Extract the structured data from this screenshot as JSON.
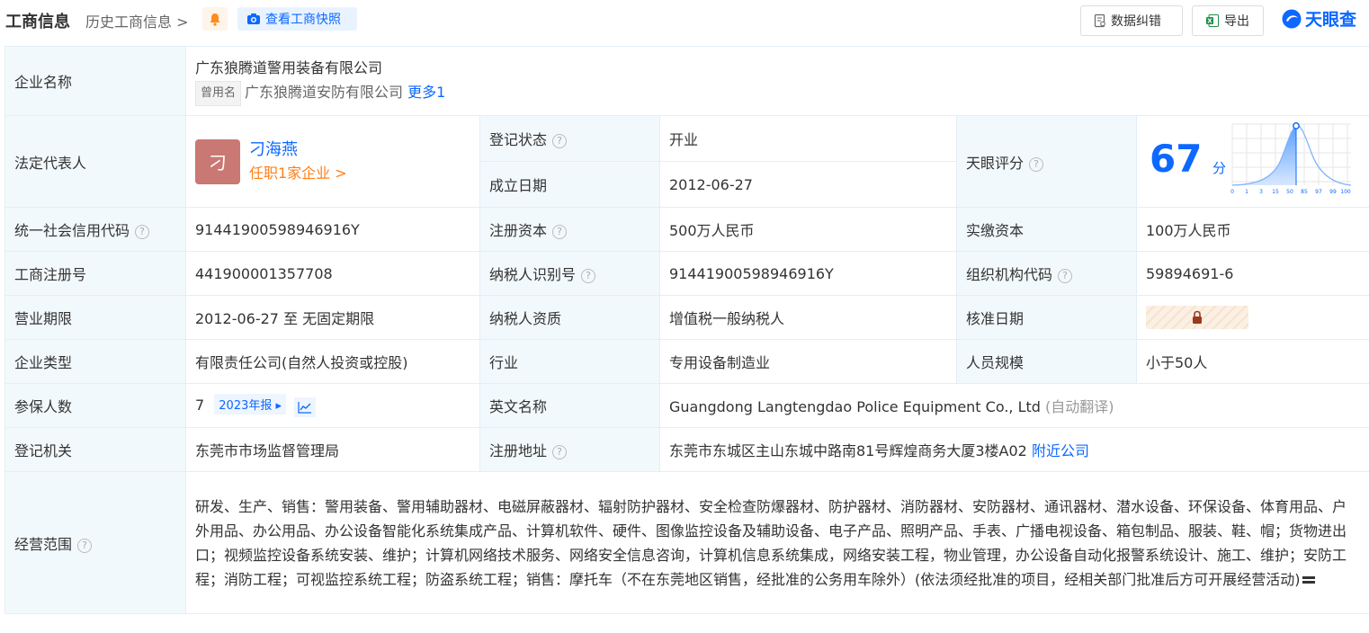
{
  "header": {
    "title": "工商信息",
    "history_label": "历史工商信息",
    "snapshot_label": "查看工商快照",
    "correct_label": "数据纠错",
    "export_label": "导出",
    "logo_text": "天眼查"
  },
  "rows": {
    "company_name": {
      "label": "企业名称",
      "value": "广东狼腾道警用装备有限公司",
      "former_tag": "曾用名",
      "former_value": "广东狼腾道安防有限公司",
      "more": "更多1"
    },
    "legal": {
      "label": "法定代表人",
      "avatar_char": "刁",
      "name": "刁海燕",
      "sub": "任职1家企业"
    },
    "reg_status": {
      "label": "登记状态",
      "value": "开业"
    },
    "found_date": {
      "label": "成立日期",
      "value": "2012-06-27"
    },
    "score": {
      "label": "天眼评分",
      "value": "67",
      "unit": "分",
      "ticks": [
        "0",
        "1",
        "3",
        "15",
        "50",
        "85",
        "97",
        "99",
        "100"
      ]
    },
    "credit_code": {
      "label": "统一社会信用代码",
      "value": "91441900598946916Y"
    },
    "reg_capital": {
      "label": "注册资本",
      "value": "500万人民币"
    },
    "paid_capital": {
      "label": "实缴资本",
      "value": "100万人民币"
    },
    "reg_no": {
      "label": "工商注册号",
      "value": "441900001357708"
    },
    "tax_id": {
      "label": "纳税人识别号",
      "value": "91441900598946916Y"
    },
    "org_code": {
      "label": "组织机构代码",
      "value": "59894691-6"
    },
    "term": {
      "label": "营业期限",
      "value": "2012-06-27 至 无固定期限"
    },
    "tax_qual": {
      "label": "纳税人资质",
      "value": "增值税一般纳税人"
    },
    "approve_date": {
      "label": "核准日期"
    },
    "company_type": {
      "label": "企业类型",
      "value": "有限责任公司(自然人投资或控股)"
    },
    "industry": {
      "label": "行业",
      "value": "专用设备制造业"
    },
    "staff_size": {
      "label": "人员规模",
      "value": "小于50人"
    },
    "insured": {
      "label": "参保人数",
      "value": "7",
      "year_tag": "2023年报"
    },
    "en_name": {
      "label": "英文名称",
      "value": "Guangdong Langtengdao Police Equipment Co., Ltd",
      "note": "(自动翻译)"
    },
    "reg_authority": {
      "label": "登记机关",
      "value": "东莞市市场监督管理局"
    },
    "reg_address": {
      "label": "注册地址",
      "value": "东莞市东城区主山东城中路南81号辉煌商务大厦3楼A02",
      "nearby": "附近公司"
    },
    "scope": {
      "label": "经营范围",
      "value": "研发、生产、销售：警用装备、警用辅助器材、电磁屏蔽器材、辐射防护器材、安全检查防爆器材、防护器材、消防器材、安防器材、通讯器材、潜水设备、环保设备、体育用品、户外用品、办公用品、办公设备智能化系统集成产品、计算机软件、硬件、图像监控设备及辅助设备、电子产品、照明产品、手表、广播电视设备、箱包制品、服装、鞋、帽；货物进出口；视频监控设备系统安装、维护；计算机网络技术服务、网络安全信息咨询，计算机信息系统集成，网络安装工程，物业管理，办公设备自动化报警系统设计、施工、维护；安防工程；消防工程；可视监控系统工程；防盗系统工程；销售：摩托车（不在东莞地区销售，经批准的公务用车除外）(依法须经批准的项目，经相关部门批准后方可开展经营活动)"
    }
  }
}
